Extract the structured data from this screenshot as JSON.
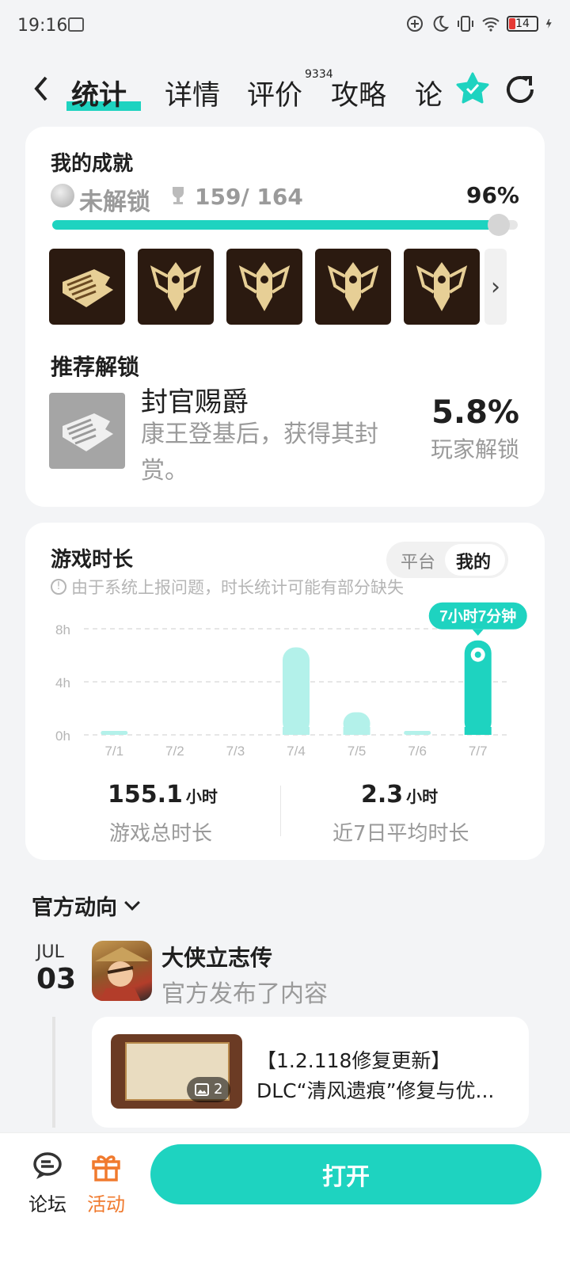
{
  "status": {
    "time": "19:16",
    "battery": "14"
  },
  "tabs": [
    {
      "label": "统计",
      "active": true
    },
    {
      "label": "详情"
    },
    {
      "label": "评价",
      "badge": "9334"
    },
    {
      "label": "攻略"
    },
    {
      "label": "论"
    }
  ],
  "achievements": {
    "title": "我的成就",
    "locked_label": "未解锁",
    "count": "159/ 164",
    "percent": "96%",
    "progress": 0.96,
    "recommend_title": "推荐解锁",
    "recommend": {
      "name": "封官赐爵",
      "desc": "康王登基后，获得其封赏。",
      "percent": "5.8%",
      "percent_label": "玩家解锁"
    }
  },
  "playtime": {
    "title": "游戏时长",
    "toggle": [
      "平台",
      "我的"
    ],
    "notice": "由于系统上报问题，时长统计可能有部分缺失",
    "tooltip": "7小时7分钟",
    "total": {
      "value": "155.1",
      "unit": "小时",
      "label": "游戏总时长"
    },
    "avg": {
      "value": "2.3",
      "unit": "小时",
      "label": "近7日平均时长"
    }
  },
  "chart_data": {
    "type": "bar",
    "categories": [
      "7/1",
      "7/2",
      "7/3",
      "7/4",
      "7/5",
      "7/6",
      "7/7"
    ],
    "values": [
      0.3,
      0,
      0,
      6.6,
      1.7,
      0.3,
      7.12
    ],
    "yticks": [
      "8h",
      "4h",
      "0h"
    ],
    "ylim": [
      0,
      8
    ],
    "highlight_index": 6,
    "colors": {
      "highlight": "#1ed3c0",
      "normal": "#b3f1ea",
      "grid": "#dddddd",
      "tick": "#b5b5b5"
    }
  },
  "official": {
    "title": "官方动向",
    "month": "JUL",
    "day": "03",
    "game": "大侠立志传",
    "sub": "官方发布了内容",
    "post_line1": "【1.2.118修复更新】",
    "post_line2": "DLC“清风遗痕”修复与优...",
    "image_count": "2"
  },
  "bottom": {
    "forum": "论坛",
    "events": "活动",
    "open": "打开"
  },
  "colors": {
    "accent": "#1ed3c0",
    "event": "#f07a2e"
  }
}
